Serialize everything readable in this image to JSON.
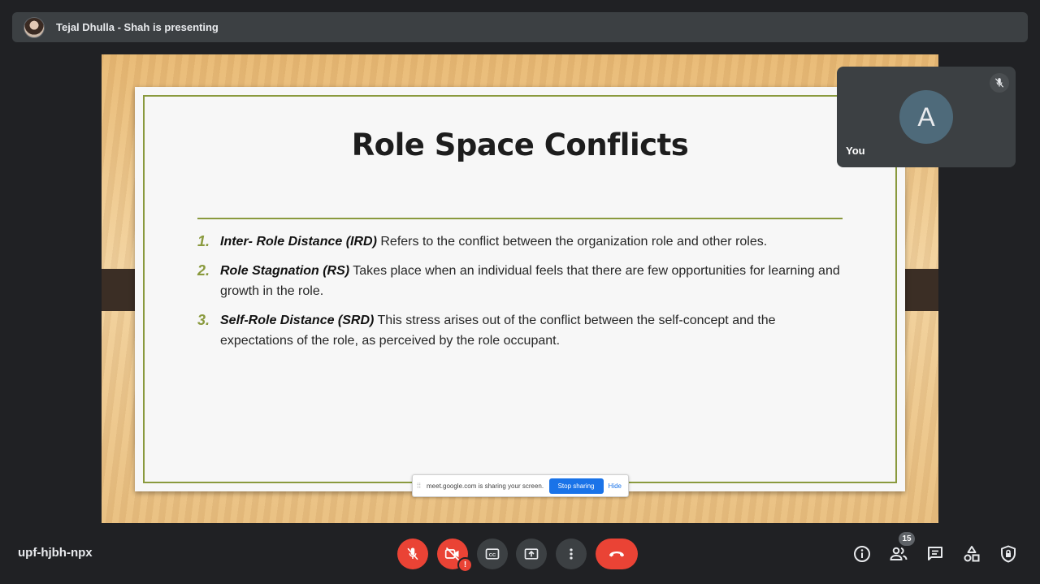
{
  "presenter": {
    "text": "Tejal Dhulla - Shah is presenting"
  },
  "slide": {
    "title": "Role Space Conflicts",
    "items": [
      {
        "num": "1.",
        "term": "Inter- Role Distance (IRD)",
        "text": " Refers to the conflict between the organization role and other roles."
      },
      {
        "num": "2.",
        "term": "Role Stagnation (RS)",
        "text": " Takes place when an individual feels that there are few opportunities for learning and growth in the role."
      },
      {
        "num": "3.",
        "term": "Self-Role Distance (SRD)",
        "text": " This stress arises out of the conflict between the self-concept and the expectations of the role, as perceived by the role occupant."
      }
    ],
    "accent_color": "#8a9a3e"
  },
  "share_notice": {
    "text": "meet.google.com is sharing your screen.",
    "stop_label": "Stop sharing",
    "hide_label": "Hide"
  },
  "self_view": {
    "initial": "A",
    "label": "You"
  },
  "bottom_bar": {
    "meeting_code": "upf-hjbh-npx",
    "participant_count": "15",
    "camera_alert": "!"
  },
  "colors": {
    "danger": "#ea4335",
    "surface": "#3c4043",
    "background": "#202124",
    "accent_blue": "#1a73e8"
  }
}
